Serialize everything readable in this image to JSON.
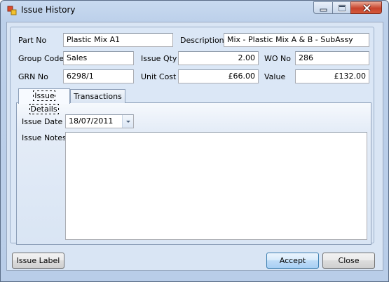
{
  "window": {
    "title": "Issue History",
    "app_icon": "application-icon"
  },
  "fields": {
    "part_no": {
      "label": "Part No",
      "value": "Plastic Mix A1"
    },
    "description": {
      "label": "Description",
      "value": "Mix - Plastic Mix A & B - SubAssy"
    },
    "group_code": {
      "label": "Group Code",
      "value": "Sales"
    },
    "issue_qty": {
      "label": "Issue Qty",
      "value": "2.00"
    },
    "wo_no": {
      "label": "WO No",
      "value": "286"
    },
    "grn_no": {
      "label": "GRN No",
      "value": "6298/1"
    },
    "unit_cost": {
      "label": "Unit Cost",
      "value": "£66.00"
    },
    "value": {
      "label": "Value",
      "value": "£132.00"
    }
  },
  "tabs": [
    {
      "label": "Issue Details",
      "active": true
    },
    {
      "label": "Transactions",
      "active": false
    }
  ],
  "issue_details": {
    "issue_date_label": "Issue Date",
    "issue_date_value": "18/07/2011",
    "issue_notes_label": "Issue Notes",
    "issue_notes_value": ""
  },
  "buttons": {
    "issue_label": "Issue Label",
    "accept": "Accept",
    "close": "Close"
  }
}
